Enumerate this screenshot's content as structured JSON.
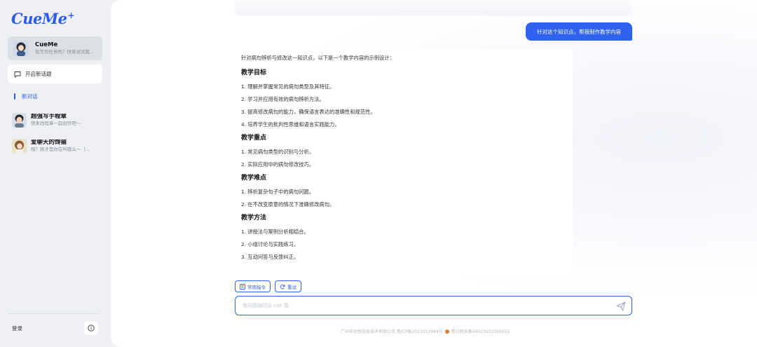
{
  "app": {
    "logo": "CueMe",
    "logo_mark": "+"
  },
  "sidebar": {
    "active_chat": {
      "name": "CueMe",
      "subtitle": "有写作任务吗？快来试试我..."
    },
    "new_topic_label": "开启新话题",
    "section_label": "新对话",
    "bots": [
      {
        "name": "超强写手程章",
        "subtitle": "快来找程章一起创作吧～"
      },
      {
        "name": "爱聊天的馋猫",
        "subtitle": "喵？刚才是你在叫我么～（..."
      }
    ],
    "login_label": "登录"
  },
  "chat": {
    "user_message": "针对这个知识点，帮我制作教学内容",
    "answer_intro": "针对病句辨析与修改这一知识点，以下是一个教学内容的示例设计：",
    "sections": [
      {
        "heading": "教学目标",
        "items": [
          "1. 理解并掌握常见的病句类型及其特征。",
          "2. 学习并应用有效的病句辨析方法。",
          "3. 提高修改病句的能力，确保语言表达的准确性和规范性。",
          "4. 培养学生的批判性思维和语言实践能力。"
        ]
      },
      {
        "heading": "教学重点",
        "items": [
          "1. 常见病句类型的识别与分析。",
          "2. 实际应用中的病句修改技巧。"
        ]
      },
      {
        "heading": "教学难点",
        "items": [
          "1. 辨析复杂句子中的病句问题。",
          "2. 在不改变原意的情况下准确修改病句。"
        ]
      },
      {
        "heading": "教学方法",
        "items": [
          "1. 讲授法与案例分析相结合。",
          "2. 小组讨论与实践练习。",
          "3. 互动问答与反馈纠正。"
        ]
      }
    ]
  },
  "actions": {
    "common_commands": "常用指令",
    "retry": "重试"
  },
  "input": {
    "placeholder": "有问题随时@ cue 我"
  },
  "footer": {
    "company": "广州市动悦信息技术有限公司 粤ICP备2022013984号",
    "police": "粤公网安备44010502000055"
  },
  "colors": {
    "accent": "#2f62ee",
    "sidebar_bg": "#eef0f4"
  }
}
